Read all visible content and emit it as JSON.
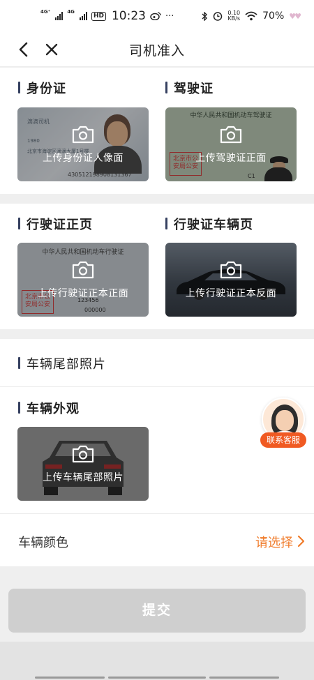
{
  "status_bar": {
    "signal1_tag": "4G⁺",
    "signal2_tag": "4G",
    "hd": "HD",
    "time": "10:23",
    "more": "···",
    "speed_value": "0.10",
    "speed_unit": "KB/s",
    "battery": "70%"
  },
  "nav": {
    "title": "司机准入",
    "back_icon": "chevron-left-icon",
    "close_icon": "close-icon"
  },
  "section_identity": {
    "id_card": {
      "label": "身份证",
      "upload_text": "上传身份证人像面",
      "sample_name": "滴滴司机",
      "sample_year": "1980",
      "sample_address": "北京市海淀区滴滴大厦1号楼",
      "sample_number": "430512198908131367"
    },
    "driver_license": {
      "label": "驾驶证",
      "upload_text": "上传驾驶证正面",
      "sample_header": "中华人民共和国机动车驾驶证",
      "sample_stamp": "北京市公安局公安",
      "sample_class": "C1"
    }
  },
  "section_vehicle_license": {
    "front": {
      "label": "行驶证正页",
      "upload_text": "上传行驶证正本正面",
      "sample_header": "中华人民共和国机动车行驶证",
      "sample_stamp": "北京市公安局公安",
      "sample_code": "123456",
      "sample_engine": "000000"
    },
    "vehicle_page": {
      "label": "行驶证车辆页",
      "upload_text": "上传行驶证正本反面"
    }
  },
  "section_vehicle": {
    "rear_photo_label": "车辆尾部照片",
    "exterior_label": "车辆外观",
    "exterior_upload_text": "上传车辆尾部照片",
    "color_label": "车辆颜色",
    "color_select": "请选择"
  },
  "customer_service": {
    "label": "联系客服"
  },
  "submit_label": "提交",
  "colors": {
    "accent": "#f07b2a",
    "service_button": "#f05a22",
    "label_bar": "#354060",
    "submit_disabled": "#cfcfcf"
  }
}
